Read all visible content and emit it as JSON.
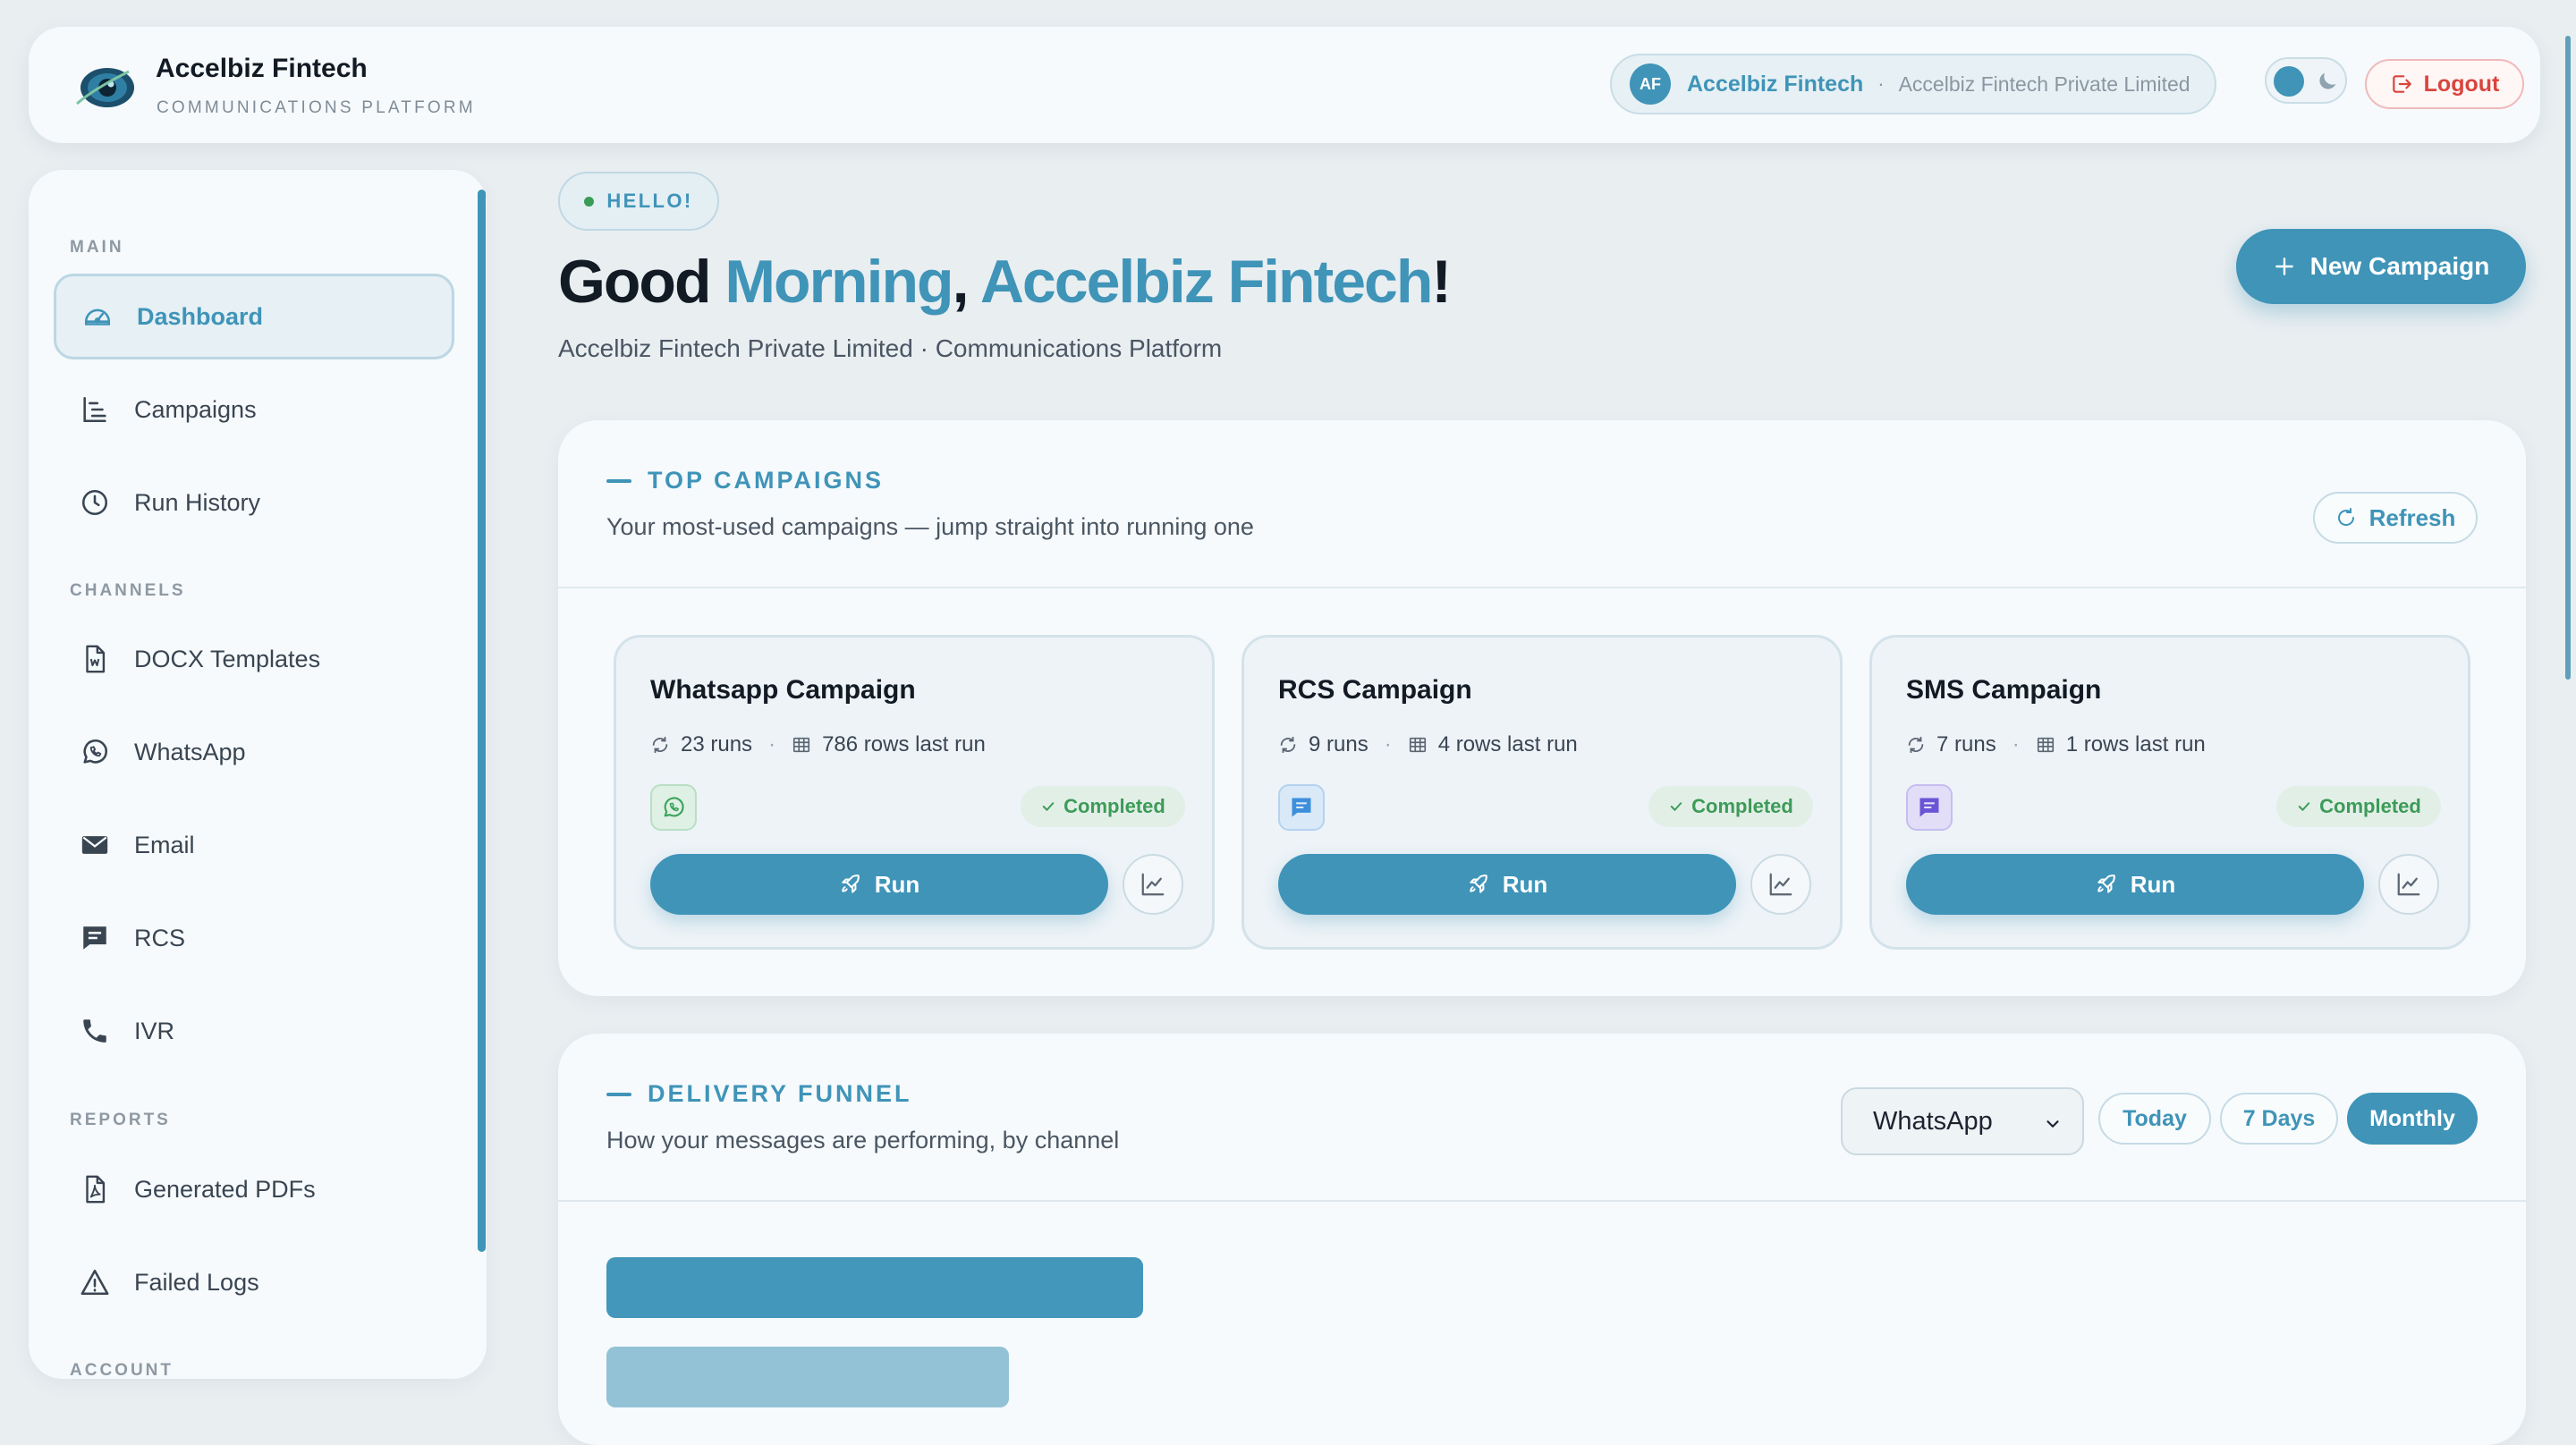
{
  "header": {
    "brand_name": "Accelbiz Fintech",
    "brand_subtitle": "COMMUNICATIONS PLATFORM",
    "org": {
      "avatar_initials": "AF",
      "name": "Accelbiz Fintech",
      "separator": "·",
      "company": "Accelbiz Fintech Private Limited"
    },
    "theme_toggle_icon": "moon-icon",
    "logout_label": "Logout"
  },
  "sidebar": {
    "sections": [
      {
        "label": "MAIN"
      },
      {
        "label": "CHANNELS"
      },
      {
        "label": "REPORTS"
      },
      {
        "label": "ACCOUNT"
      }
    ],
    "items": [
      {
        "label": "Dashboard",
        "icon": "gauge-icon",
        "active": true
      },
      {
        "label": "Campaigns",
        "icon": "list-tree-icon"
      },
      {
        "label": "Run History",
        "icon": "clock-icon"
      },
      {
        "label": "DOCX Templates",
        "icon": "word-file-icon"
      },
      {
        "label": "WhatsApp",
        "icon": "whatsapp-icon"
      },
      {
        "label": "Email",
        "icon": "envelope-icon"
      },
      {
        "label": "RCS",
        "icon": "message-icon"
      },
      {
        "label": "IVR",
        "icon": "phone-icon"
      },
      {
        "label": "Generated PDFs",
        "icon": "pdf-file-icon"
      },
      {
        "label": "Failed Logs",
        "icon": "warning-icon"
      }
    ]
  },
  "main": {
    "hello_label": "HELLO!",
    "greeting": {
      "prefix": "Good ",
      "time_of_day": "Morning",
      "comma": ", ",
      "name": "Accelbiz Fintech",
      "suffix": "!"
    },
    "subtitle": "Accelbiz Fintech Private Limited · Communications Platform",
    "new_campaign_label": "New Campaign"
  },
  "top_campaigns": {
    "title": "TOP CAMPAIGNS",
    "description": "Your most-used campaigns — jump straight into running one",
    "refresh_label": "Refresh",
    "cards": [
      {
        "name": "Whatsapp Campaign",
        "runs": "23 runs",
        "rows": "786 rows last run",
        "channel_icon": "whatsapp-icon",
        "status": "Completed",
        "run_label": "Run"
      },
      {
        "name": "RCS Campaign",
        "runs": "9 runs",
        "rows": "4 rows last run",
        "channel_icon": "rcs-message-icon",
        "status": "Completed",
        "run_label": "Run"
      },
      {
        "name": "SMS Campaign",
        "runs": "7 runs",
        "rows": "1 rows last run",
        "channel_icon": "sms-message-icon",
        "status": "Completed",
        "run_label": "Run"
      }
    ]
  },
  "delivery_funnel": {
    "title": "DELIVERY FUNNEL",
    "description": "How your messages are performing, by channel",
    "channel_selected": "WhatsApp",
    "periods": [
      {
        "label": "Today",
        "active": false
      },
      {
        "label": "7 Days",
        "active": false
      },
      {
        "label": "Monthly",
        "active": true
      }
    ],
    "bars": [
      {
        "value": 1.0,
        "color": "#4297ba"
      },
      {
        "value": 0.75,
        "color": "#93c2d6"
      }
    ]
  },
  "colors": {
    "accent": "#3f94b8",
    "success": "#3d9b58",
    "danger": "#d9443d"
  }
}
